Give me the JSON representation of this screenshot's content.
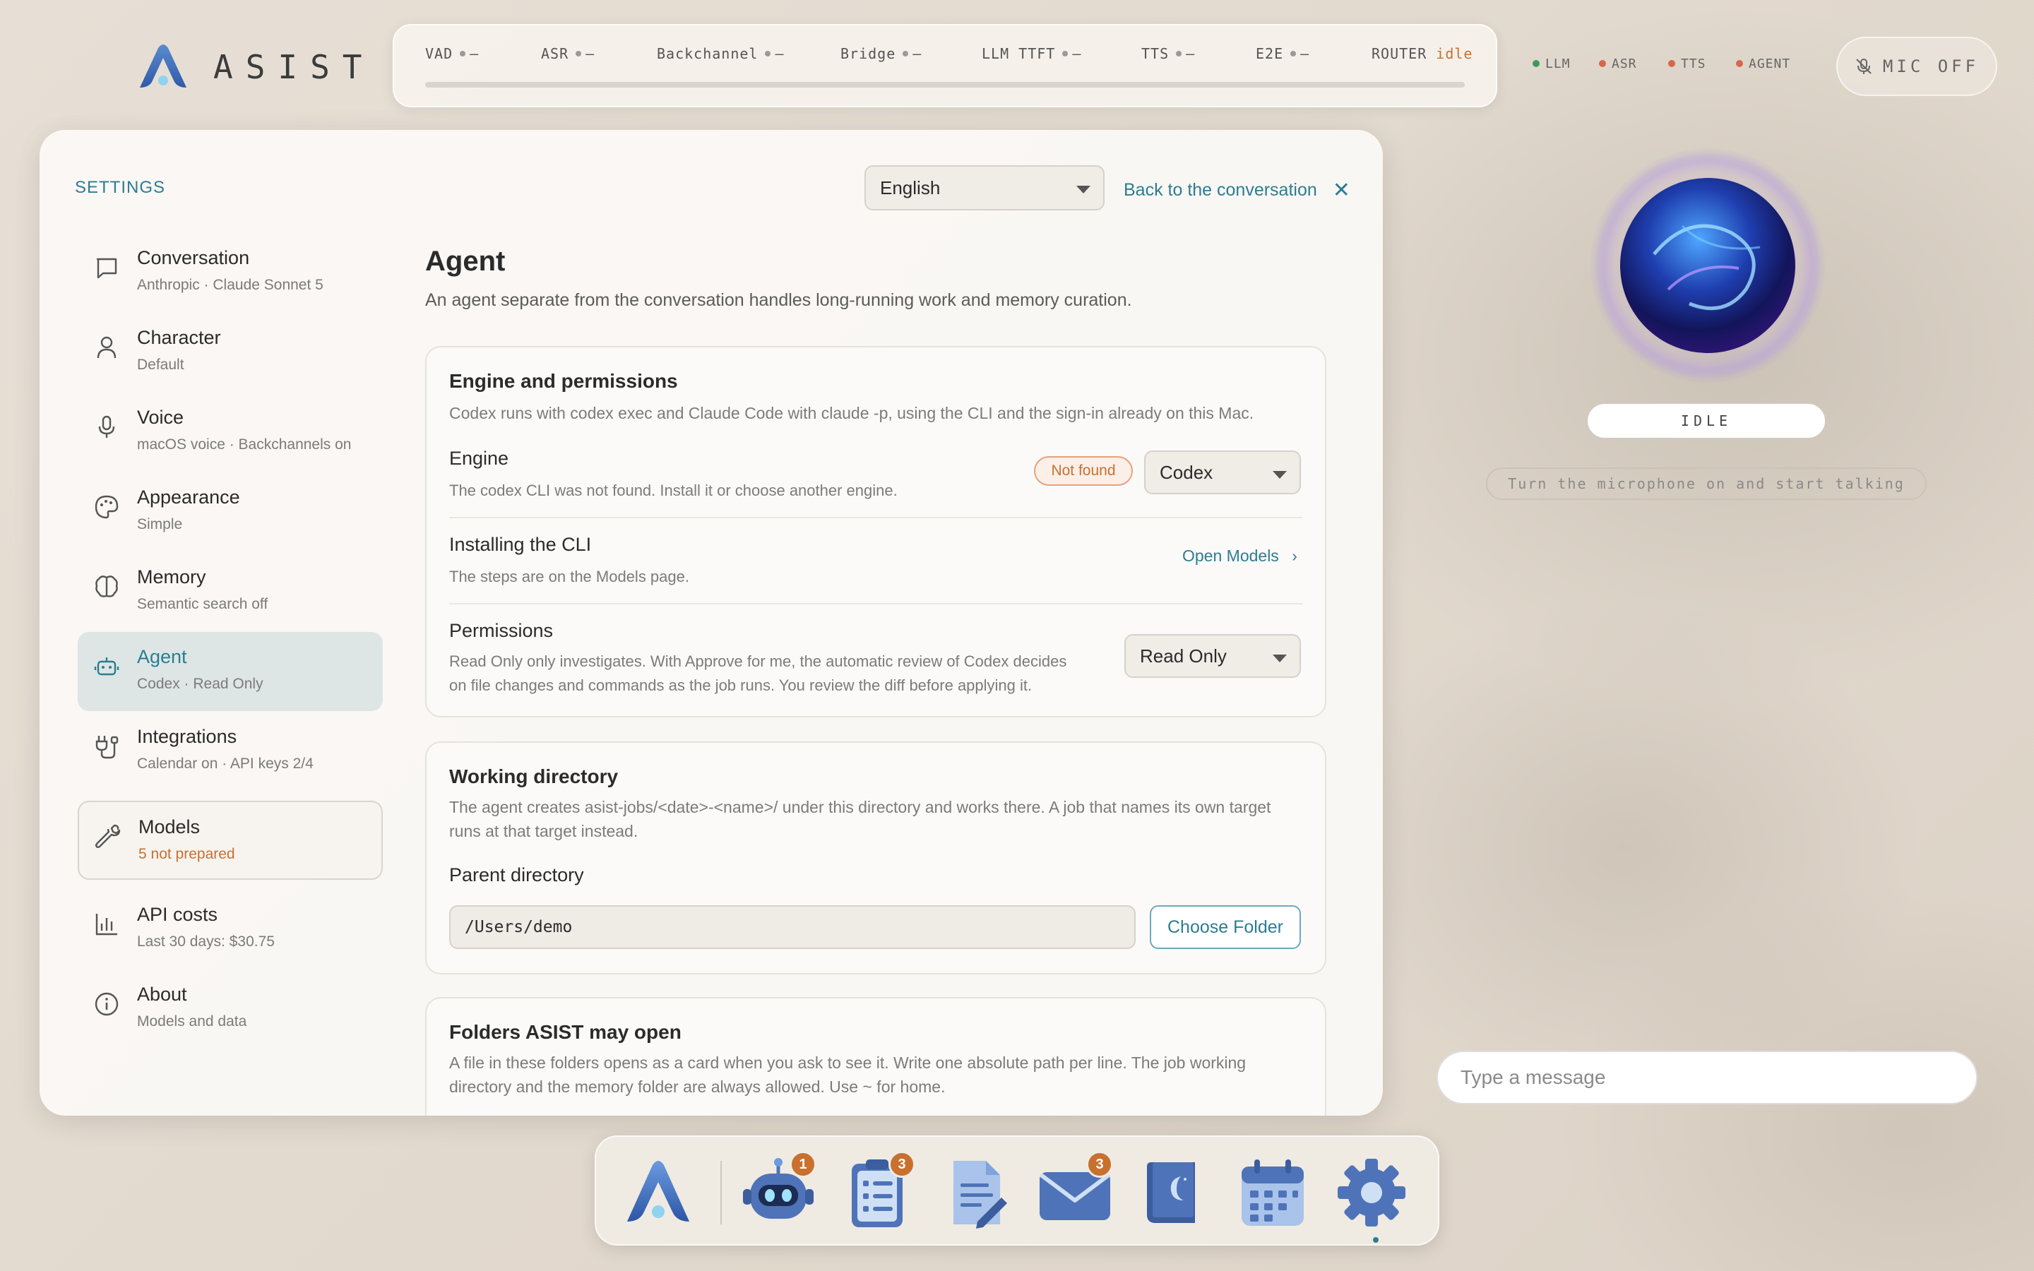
{
  "app": {
    "name": "ASIST"
  },
  "metrics": [
    {
      "label": "VAD",
      "value": "—"
    },
    {
      "label": "ASR",
      "value": "—"
    },
    {
      "label": "Backchannel",
      "value": "—"
    },
    {
      "label": "Bridge",
      "value": "—"
    },
    {
      "label": "LLM TTFT",
      "value": "—"
    },
    {
      "label": "TTS",
      "value": "—"
    },
    {
      "label": "E2E",
      "value": "—"
    },
    {
      "label": "ROUTER",
      "value": "idle"
    }
  ],
  "status": [
    {
      "label": "LLM",
      "color": "#3f9a5a"
    },
    {
      "label": "ASR",
      "color": "#d9664a"
    },
    {
      "label": "TTS",
      "color": "#d9664a"
    },
    {
      "label": "AGENT",
      "color": "#d9664a"
    }
  ],
  "mic": {
    "label": "MIC OFF"
  },
  "orb": {
    "state": "IDLE",
    "hint": "Turn the microphone on and start talking"
  },
  "message": {
    "placeholder": "Type a message"
  },
  "settings": {
    "title": "SETTINGS",
    "language": "English",
    "back_label": "Back to the conversation",
    "nav": [
      {
        "label": "Conversation",
        "sub": "Anthropic · Claude Sonnet 5",
        "icon": "chat-bubble-icon"
      },
      {
        "label": "Character",
        "sub": "Default",
        "icon": "person-icon"
      },
      {
        "label": "Voice",
        "sub": "macOS voice · Backchannels on",
        "icon": "microphone-icon"
      },
      {
        "label": "Appearance",
        "sub": "Simple",
        "icon": "palette-icon"
      },
      {
        "label": "Memory",
        "sub": "Semantic search off",
        "icon": "brain-icon"
      },
      {
        "label": "Agent",
        "sub": "Codex · Read Only",
        "icon": "robot-icon"
      },
      {
        "label": "Integrations",
        "sub": "Calendar on · API keys 2/4",
        "icon": "plug-icon"
      },
      {
        "label": "Models",
        "sub": "5 not prepared",
        "icon": "wrench-icon"
      },
      {
        "label": "API costs",
        "sub": "Last 30 days: $30.75",
        "icon": "bar-chart-icon"
      },
      {
        "label": "About",
        "sub": "Models and data",
        "icon": "info-icon"
      }
    ],
    "active": "Agent"
  },
  "agent": {
    "title": "Agent",
    "description": "An agent separate from the conversation handles long-running work and memory curation.",
    "engine_card": {
      "title": "Engine and permissions",
      "description": "Codex runs with codex exec and Claude Code with claude -p, using the CLI and the sign-in already on this Mac.",
      "engine_label": "Engine",
      "engine_sub": "The codex CLI was not found. Install it or choose another engine.",
      "engine_badge": "Not found",
      "engine_value": "Codex",
      "install_label": "Installing the CLI",
      "install_sub": "The steps are on the Models page.",
      "open_models": "Open Models",
      "permissions_label": "Permissions",
      "permissions_sub1": "Read Only only investigates. With Approve for me, the automatic review of Codex decides",
      "permissions_sub2": "on file changes and commands as the job runs. You review the diff before applying it.",
      "permissions_value": "Read Only"
    },
    "workdir_card": {
      "title": "Working directory",
      "description1": "The agent creates asist-jobs/<date>-<name>/ under this directory and works there. A job that names its own target",
      "description2": "runs at that target instead.",
      "parent_label": "Parent directory",
      "path": "/Users/demo",
      "choose": "Choose Folder"
    },
    "folders_card": {
      "title": "Folders ASIST may open",
      "description1": "A file in these folders opens as a card when you ask to see it. Write one absolute path per line. The job working",
      "description2": "directory and the memory folder are always allowed. Use ~ for home."
    }
  },
  "dock": [
    {
      "name": "asist-app-icon",
      "badge": ""
    },
    {
      "name": "agent-robot-icon",
      "badge": "1"
    },
    {
      "name": "tasks-clipboard-icon",
      "badge": "3"
    },
    {
      "name": "notes-document-icon",
      "badge": ""
    },
    {
      "name": "mail-envelope-icon",
      "badge": "3"
    },
    {
      "name": "journal-book-icon",
      "badge": ""
    },
    {
      "name": "calendar-icon",
      "badge": ""
    },
    {
      "name": "settings-gear-icon",
      "badge": ""
    }
  ]
}
